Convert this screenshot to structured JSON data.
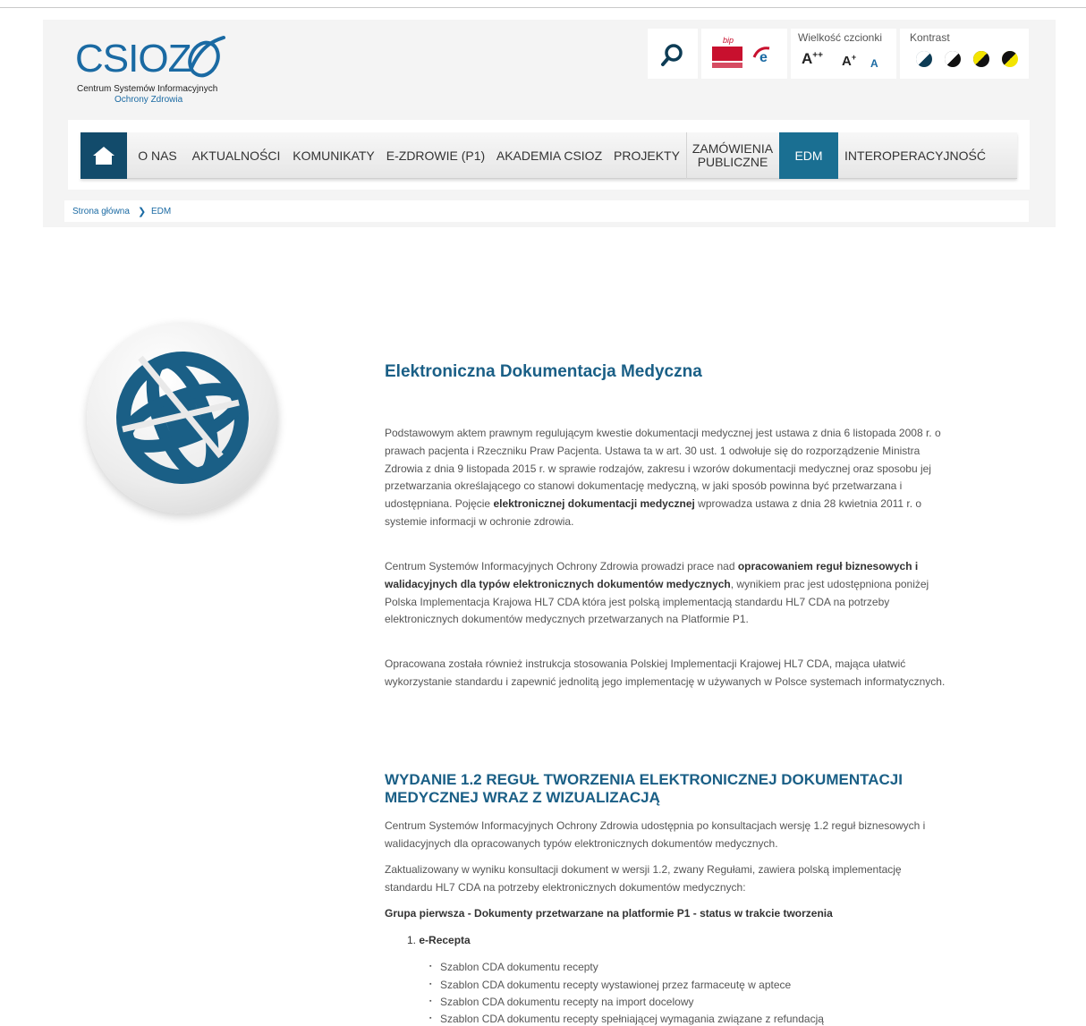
{
  "logo": {
    "wordmark": "CSIOZ",
    "subtitle_line1": "Centrum Systemów Informacyjnych",
    "subtitle_line2": "Ochrony Zdrowia"
  },
  "toolbar": {
    "bip_label": "bip",
    "font_size_label": "Wielkość czcionki",
    "font_large": "A",
    "font_large_sup": "++",
    "font_medium": "A",
    "font_medium_sup": "+",
    "font_small": "A",
    "contrast_label": "Kontrast"
  },
  "nav": {
    "items": [
      {
        "label": "O NAS"
      },
      {
        "label": "AKTUALNOŚCI"
      },
      {
        "label": "KOMUNIKATY"
      },
      {
        "label": "E-ZDROWIE (P1)"
      },
      {
        "label": "AKADEMIA CSIOZ"
      },
      {
        "label": "PROJEKTY"
      },
      {
        "label": "ZAMÓWIENIA PUBLICZNE"
      },
      {
        "label": "EDM"
      },
      {
        "label": "INTEROPERACYJNOŚĆ"
      }
    ],
    "active": "EDM"
  },
  "breadcrumb": {
    "home": "Strona główna",
    "current": "EDM"
  },
  "main": {
    "title": "Elektroniczna Dokumentacja Medyczna",
    "p1_a": "Podstawowym aktem prawnym regulującym kwestie dokumentacji medycznej jest ustawa z dnia 6 listopada 2008 r. o prawach pacjenta i Rzeczniku Praw Pacjenta. Ustawa ta w art. 30 ust. 1 odwołuje się do  rozporządzenie Ministra Zdrowia z dnia 9 listopada 2015 r. w sprawie rodzajów, zakresu i wzorów dokumentacji medycznej oraz sposobu jej przetwarzania określającego co stanowi dokumentację medyczną, w jaki sposób powinna być przetwarzana i udostępniana. Pojęcie ",
    "p1_bold": "elektronicznej dokumentacji medycznej",
    "p1_b": " wprowadza ustawa z dnia 28 kwietnia 2011 r. o systemie informacji w ochronie zdrowia.",
    "p2_a": "Centrum Systemów Informacyjnych Ochrony Zdrowia prowadzi prace nad ",
    "p2_bold": "opracowaniem reguł biznesowych i walidacyjnych dla typów elektronicznych dokumentów medycznych",
    "p2_b": ", wynikiem prac jest udostępniona poniżej Polska Implementacja Krajowa HL7 CDA która jest polską implementacją standardu HL7 CDA na potrzeby elektronicznych dokumentów medycznych przetwarzanych na Platformie P1.",
    "p3": "Opracowana została również  instrukcja stosowania Polskiej Implementacji Krajowej HL7 CDA, mająca ułatwić wykorzystanie standardu i zapewnić jednolitą jego implementację w używanych w Polsce systemach informatycznych.",
    "section_title": "WYDANIE 1.2 REGUŁ TWORZENIA ELEKTRONICZNEJ DOKUMENTACJI MEDYCZNEJ WRAZ Z WIZUALIZACJĄ",
    "p4": "Centrum Systemów Informacyjnych Ochrony Zdrowia udostępnia po konsultacjach wersję 1.2 reguł biznesowych i walidacyjnych dla opracowanych typów elektronicznych dokumentów medycznych.",
    "p5": "Zaktualizowany w wyniku konsultacji dokument w wersji 1.2, zwany Regułami, zawiera polską implementację standardu HL7 CDA na potrzeby elektronicznych dokumentów medycznych:",
    "group_title": "Grupa pierwsza - Dokumenty przetwarzane na platformie P1 - status w trakcie tworzenia",
    "ol_number": "1.",
    "ol_label": "e-Recepta",
    "templates": [
      "Szablon CDA dokumentu recepty",
      "Szablon CDA dokumentu recepty wystawionej przez farmaceutę w aptece",
      "Szablon CDA dokumentu recepty na import docelowy",
      "Szablon CDA dokumentu recepty spełniającej wymagania związane z refundacją"
    ]
  },
  "colors": {
    "brand": "#1a6aa3",
    "nav_active": "#1a6f92",
    "home": "#124b6b",
    "heading": "#1a5f86"
  }
}
